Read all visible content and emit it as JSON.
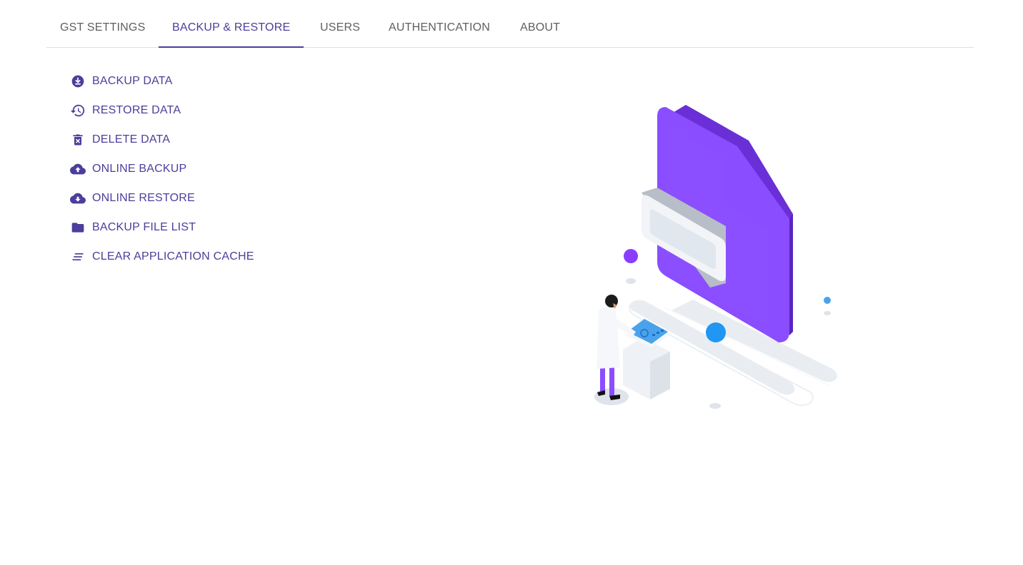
{
  "tabs": [
    {
      "label": "GST SETTINGS",
      "active": false
    },
    {
      "label": "BACKUP & RESTORE",
      "active": true
    },
    {
      "label": "USERS",
      "active": false
    },
    {
      "label": "AUTHENTICATION",
      "active": false
    },
    {
      "label": "ABOUT",
      "active": false
    }
  ],
  "menu": [
    {
      "label": "BACKUP DATA",
      "icon": "download-circle-icon"
    },
    {
      "label": "RESTORE DATA",
      "icon": "history-icon"
    },
    {
      "label": "DELETE DATA",
      "icon": "trash-icon"
    },
    {
      "label": "ONLINE BACKUP",
      "icon": "cloud-upload-icon"
    },
    {
      "label": "ONLINE RESTORE",
      "icon": "cloud-download-icon"
    },
    {
      "label": "BACKUP FILE LIST",
      "icon": "folder-icon"
    },
    {
      "label": "CLEAR APPLICATION CACHE",
      "icon": "clear-all-icon"
    }
  ],
  "colors": {
    "accent": "#4a3f9b",
    "illustration_purple": "#8a4dff",
    "illustration_blue": "#2196f3"
  },
  "illustration": {
    "icon": "backup-illustration"
  }
}
